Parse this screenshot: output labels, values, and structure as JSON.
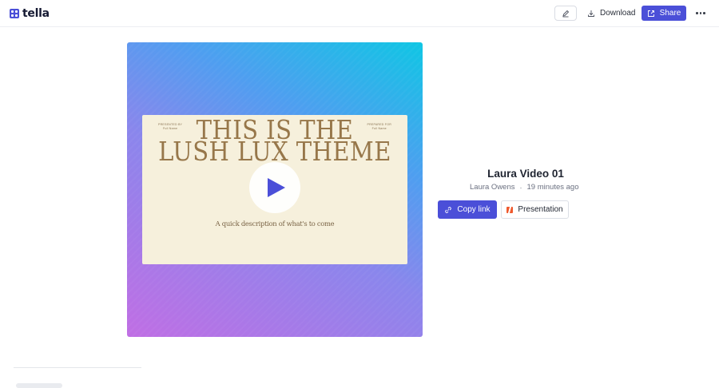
{
  "app": {
    "logo_text": "tella"
  },
  "toolbar": {
    "edit_icon": "pencil-icon",
    "download_label": "Download",
    "download_icon": "download-icon",
    "share_label": "Share",
    "share_icon": "share-icon",
    "more_icon": "more-horizontal-icon",
    "accent": "#4b4fd8"
  },
  "video": {
    "slide": {
      "presented_by": "PRESENTED BY",
      "presented_name": "Full Name",
      "prepared_for": "PREPARED FOR",
      "prepared_name": "Full Name",
      "title": "THIS IS THE LUSH LUX THEME",
      "description": "A quick description of what's to come"
    },
    "play_icon": "play-icon"
  },
  "info": {
    "title": "Laura Video 01",
    "author": "Laura Owens",
    "separator": "·",
    "time": "19 minutes ago",
    "copy_link_label": "Copy link",
    "presentation_label": "Presentation"
  }
}
